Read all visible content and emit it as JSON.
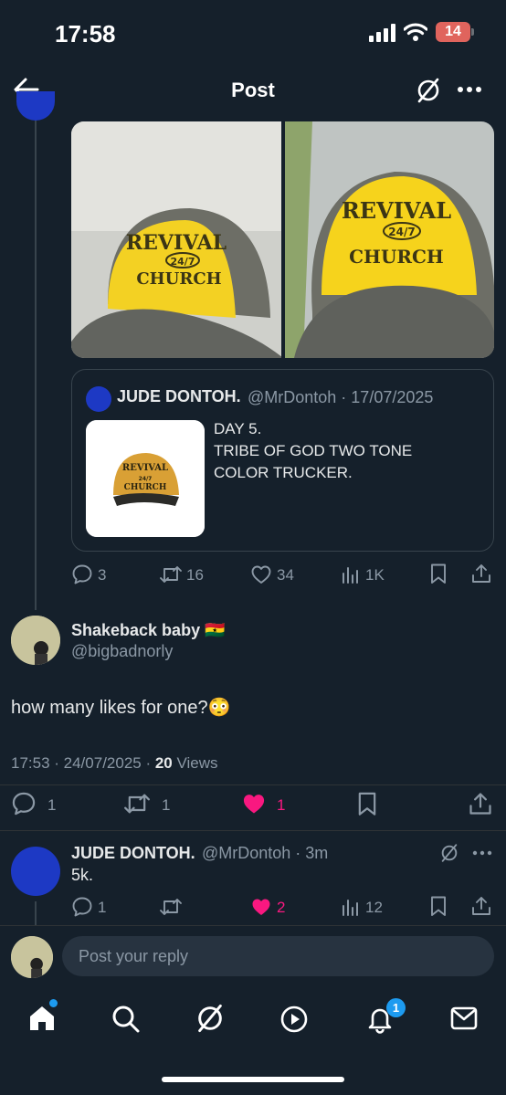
{
  "status_bar": {
    "time": "17:58",
    "battery": "14"
  },
  "header": {
    "title": "Post"
  },
  "quoted_post": {
    "name": "JUDE DONTOH.",
    "handle_time": "@MrDontoh · 17/07/2025",
    "text_lines": [
      "DAY 5.",
      "TRIBE OF GOD TWO TONE",
      "COLOR TRUCKER."
    ]
  },
  "cap_print": {
    "line1": "REVIVAL",
    "line2": "24/7",
    "line3": "CHURCH"
  },
  "main_actions": {
    "replies": "3",
    "reposts": "16",
    "likes": "34",
    "views": "1K"
  },
  "reply_post": {
    "name": "Shakeback baby",
    "flag": "🇬🇭",
    "handle": "@bigbadnorly",
    "text": "how many likes for one?",
    "emoji": "😳",
    "timestamp": "17:53 · 24/07/2025 · ",
    "views_count": "20",
    "views_label": " Views",
    "actions": {
      "replies": "1",
      "reposts": "1",
      "likes": "1"
    }
  },
  "sub_reply": {
    "name": "JUDE DONTOH.",
    "handle_time": "@MrDontoh · 3m",
    "text": "5k.",
    "actions": {
      "replies": "1",
      "reposts": "",
      "likes": "2",
      "views": "12"
    }
  },
  "composer": {
    "placeholder": "Post your reply"
  },
  "tabbar": {
    "notifications_badge": "1"
  },
  "colors": {
    "background": "#15202b",
    "like_pink": "#f91880",
    "accent_blue": "#1d9bf0"
  }
}
